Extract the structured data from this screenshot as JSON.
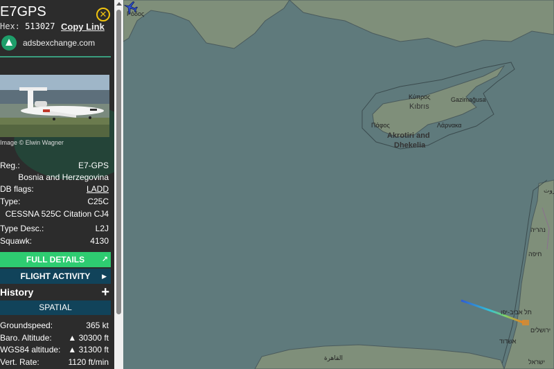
{
  "aircraft": {
    "callsign": "E7GPS",
    "hex_label": "Hex:",
    "hex": "513027",
    "copy_link": "Copy Link",
    "close_glyph": "✕",
    "source": "adsbexchange.com"
  },
  "photo": {
    "credit": "Image © Elwin Wagner"
  },
  "details": {
    "reg_label": "Reg.:",
    "reg": "E7-GPS",
    "country": "Bosnia and Herzegovina",
    "db_flags_label": "DB flags:",
    "db_flags": "LADD",
    "type_label": "Type:",
    "type": "C25C",
    "type_full": "CESSNA 525C Citation CJ4",
    "type_desc_label": "Type Desc.:",
    "type_desc": "L2J",
    "squawk_label": "Squawk:",
    "squawk": "4130"
  },
  "buttons": {
    "full_details": "FULL DETAILS",
    "full_details_icon": "↗",
    "flight_activity": "FLIGHT ACTIVITY",
    "flight_activity_icon": "▶",
    "history": "History",
    "history_toggle": "+",
    "spatial": "SPATIAL"
  },
  "spatial": {
    "groundspeed_label": "Groundspeed:",
    "groundspeed": "365 kt",
    "baro_label": "Baro. Altitude:",
    "baro": "▲ 30300 ft",
    "wgs_label": "WGS84 altitude:",
    "wgs": "▲ 31300 ft",
    "vrate_label": "Vert. Rate:",
    "vrate": "1120 ft/min"
  },
  "map": {
    "labels": {
      "rodos": "Ρόδος",
      "kypros": "Κύπρος",
      "kibris": "Kıbrıs",
      "gazimagusa": "Gazimağusa",
      "pafos": "Πάφος",
      "larnaka": "Λάρνακα",
      "akrotiri": "Akrotiri and",
      "dhekelia": "Dhekelia",
      "nahariya": "נהריה",
      "haifa": "חיפה",
      "telaviv": "תל אביב-יפו",
      "jerusalem": "ירושלים",
      "ashdod": "אשדוד",
      "israel": "ישראל",
      "beirut": "بيروت",
      "cairo": "القاهرة"
    },
    "colors": {
      "sea": "#5f7a7c",
      "land": "#7f8f7a",
      "track_start": "#2d5bd6",
      "track_end": "#f07a18"
    }
  }
}
